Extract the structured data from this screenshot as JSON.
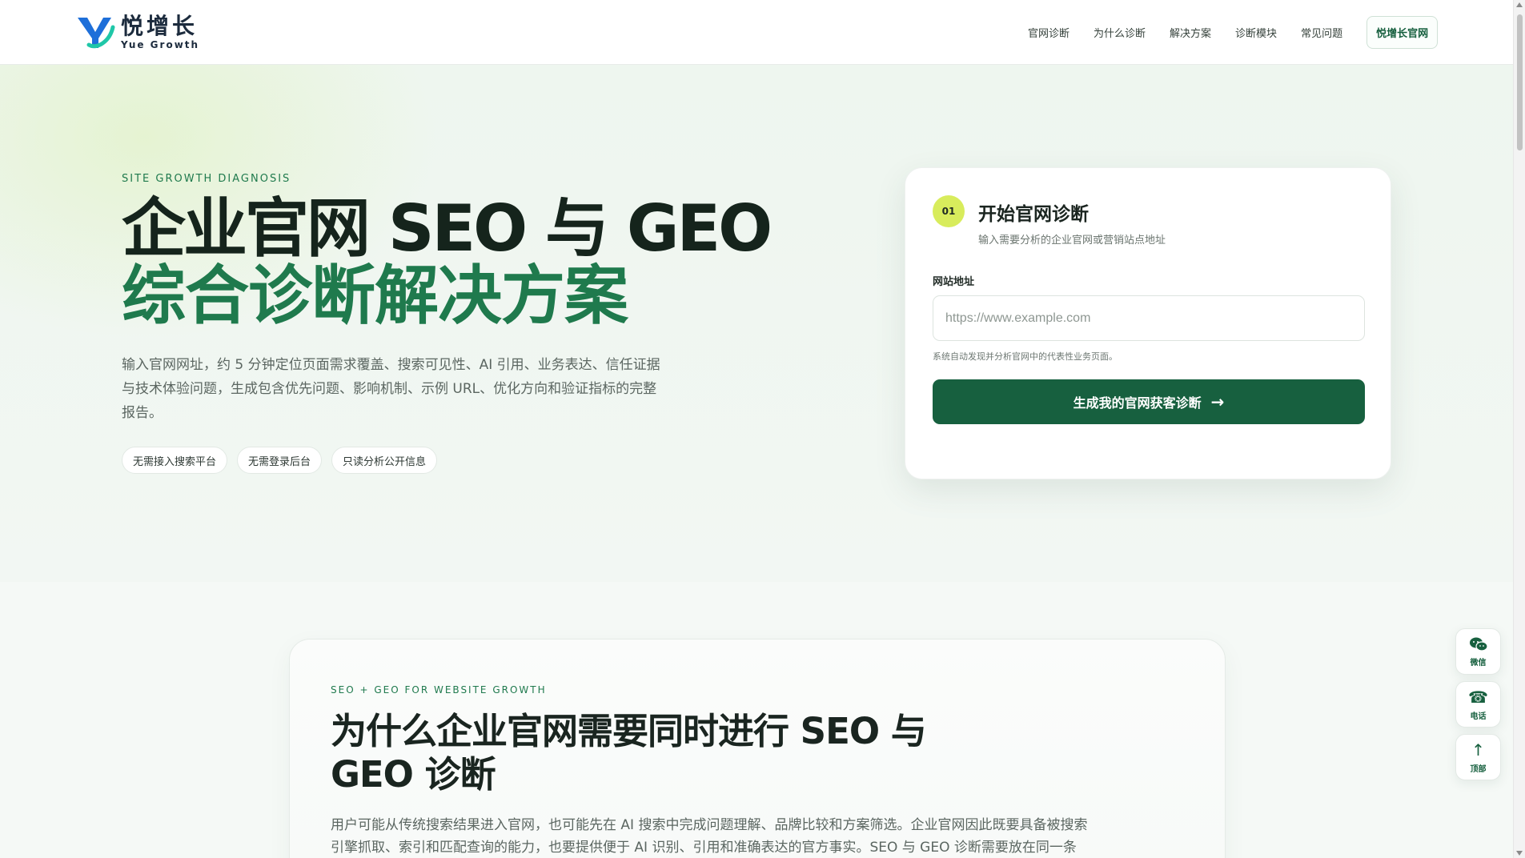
{
  "brand": {
    "name_cn": "悦增长",
    "name_en": "Yue Growth"
  },
  "nav": {
    "items": [
      {
        "label": "官网诊断"
      },
      {
        "label": "为什么诊断"
      },
      {
        "label": "解决方案"
      },
      {
        "label": "诊断模块"
      },
      {
        "label": "常见问题"
      }
    ],
    "cta": "悦增长官网"
  },
  "hero": {
    "eyebrow": "SITE GROWTH DIAGNOSIS",
    "title_line1": "企业官网 SEO 与 GEO",
    "title_line2": "综合诊断解决方案",
    "description": "输入官网网址，约 5 分钟定位页面需求覆盖、搜索可见性、AI 引用、业务表达、信任证据与技术体验问题，生成包含优先问题、影响机制、示例 URL、优化方向和验证指标的完整报告。",
    "tags": [
      "无需接入搜索平台",
      "无需登录后台",
      "只读分析公开信息"
    ]
  },
  "form": {
    "step": "01",
    "title": "开始官网诊断",
    "subtitle": "输入需要分析的企业官网或营销站点地址",
    "field_label": "网站地址",
    "placeholder": "https://www.example.com",
    "value": "",
    "hint": "系统自动发现并分析官网中的代表性业务页面。",
    "submit_label": "生成我的官网获客诊断",
    "submit_arrow": "→"
  },
  "section2": {
    "eyebrow": "SEO + GEO FOR WEBSITE GROWTH",
    "title": "为什么企业官网需要同时进行 SEO 与 GEO 诊断",
    "description": "用户可能从传统搜索结果进入官网，也可能先在 AI 搜索中完成问题理解、品牌比较和方案筛选。企业官网因此既要具备被搜索引擎抓取、索引和匹配查询的能力，也要提供便于 AI 识别、引用和准确表达的官方事实。SEO 与 GEO 诊断需要放在同一条"
  },
  "float": {
    "wechat": {
      "label": "微信",
      "icon": "wechat-icon"
    },
    "phone": {
      "label": "电话",
      "icon": "phone-icon"
    },
    "top": {
      "label": "顶部",
      "icon": "arrow-up-icon"
    }
  },
  "colors": {
    "brand_green": "#17603f",
    "accent_green": "#1f7a4d",
    "badge_lime": "#d8ec5c",
    "logo_navy": "#1c2b3d",
    "logo_blue": "#1e6fd9",
    "logo_teal": "#1fc7a8"
  }
}
